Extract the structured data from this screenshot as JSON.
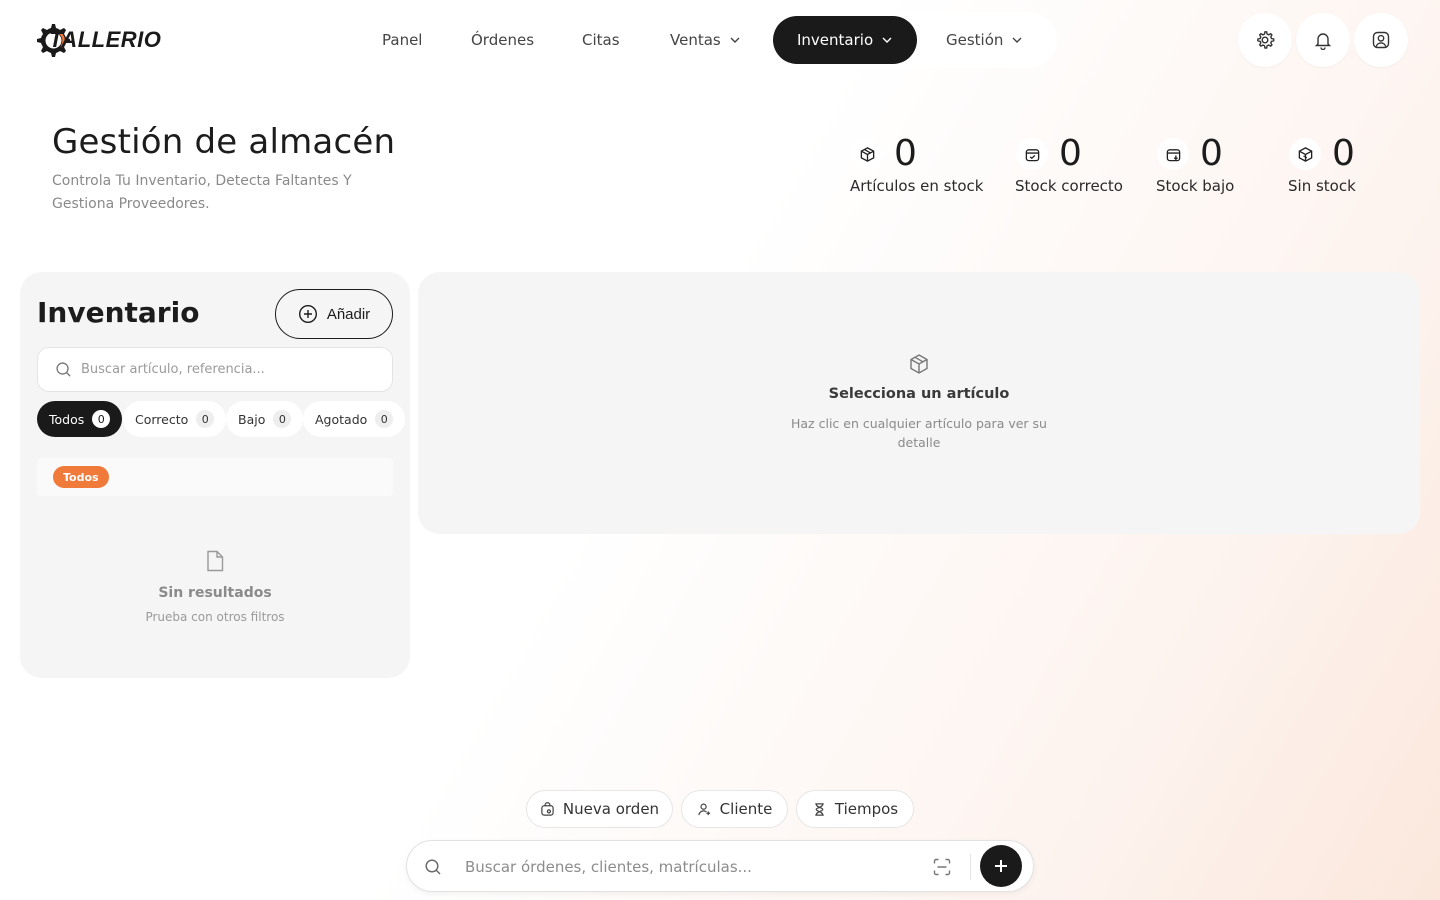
{
  "brand": {
    "name": "TALLERIO",
    "accent": "#f07a3a"
  },
  "nav": {
    "items": [
      {
        "label": "Panel"
      },
      {
        "label": "Órdenes"
      },
      {
        "label": "Citas"
      },
      {
        "label": "Ventas",
        "dropdown": true
      },
      {
        "label": "Inventario",
        "dropdown": true,
        "active": true
      },
      {
        "label": "Gestión",
        "dropdown": true
      }
    ],
    "actions": [
      "gear-icon",
      "bell-icon",
      "user-icon"
    ]
  },
  "header": {
    "title": "Gestión de almacén",
    "subtitle": "Controla Tu Inventario, Detecta Faltantes Y Gestiona Proveedores."
  },
  "stats": [
    {
      "value": "0",
      "label": "Artículos en stock",
      "icon": "box-icon"
    },
    {
      "value": "0",
      "label": "Stock correcto",
      "icon": "box-check-icon"
    },
    {
      "value": "0",
      "label": "Stock bajo",
      "icon": "box-down-icon"
    },
    {
      "value": "0",
      "label": "Sin stock",
      "icon": "box-empty-icon"
    }
  ],
  "inventory": {
    "title": "Inventario",
    "add_label": "Añadir",
    "search_placeholder": "Buscar artículo, referencia...",
    "filters": [
      {
        "label": "Todos",
        "count": "0",
        "active": true
      },
      {
        "label": "Correcto",
        "count": "0"
      },
      {
        "label": "Bajo",
        "count": "0"
      },
      {
        "label": "Agotado",
        "count": "0"
      }
    ],
    "group_label": "Todos",
    "empty_title": "Sin resultados",
    "empty_subtitle": "Prueba con otros filtros"
  },
  "detail": {
    "empty_title": "Selecciona un artículo",
    "empty_subtitle": "Haz clic en cualquier artículo para ver su detalle"
  },
  "quick_actions": [
    {
      "label": "Nueva orden",
      "icon": "order-icon"
    },
    {
      "label": "Cliente",
      "icon": "user-add-icon"
    },
    {
      "label": "Tiempos",
      "icon": "hourglass-icon"
    }
  ],
  "command_bar": {
    "placeholder": "Buscar órdenes, clientes, matrículas..."
  }
}
